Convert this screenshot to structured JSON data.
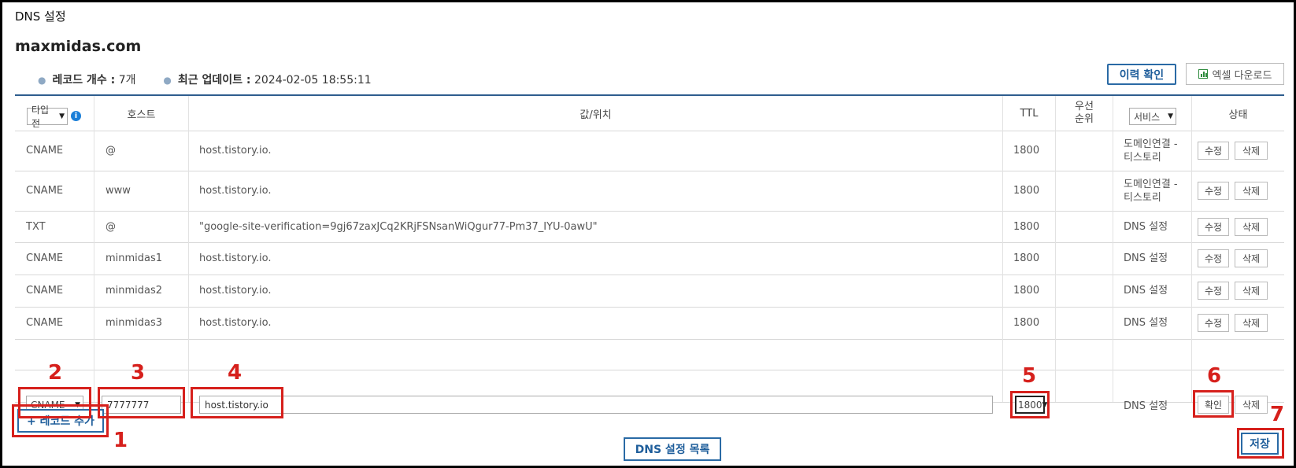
{
  "page_title": "DNS 설정",
  "domain": "maxmidas.com",
  "meta": {
    "record_count_label": "레코드 개수 :",
    "record_count_value": "7개",
    "updated_label": "최근 업데이트 :",
    "updated_value": "2024-02-05 18:55:11"
  },
  "actions": {
    "history_label": "이력 확인",
    "excel_label": "엑셀 다운로드"
  },
  "table": {
    "headers": {
      "type_select": "타입 전",
      "host": "호스트",
      "value": "값/위치",
      "ttl": "TTL",
      "priority_1": "우선",
      "priority_2": "순위",
      "service_select": "서비스",
      "status": "상태"
    },
    "rows": [
      {
        "type": "CNAME",
        "host": "@",
        "value": "host.tistory.io.",
        "ttl": "1800",
        "service_1": "도메인연결 -",
        "service_2": "티스토리",
        "edit": "수정",
        "delete": "삭제"
      },
      {
        "type": "CNAME",
        "host": "www",
        "value": "host.tistory.io.",
        "ttl": "1800",
        "service_1": "도메인연결 -",
        "service_2": "티스토리",
        "edit": "수정",
        "delete": "삭제"
      },
      {
        "type": "TXT",
        "host": "@",
        "value": "\"google-site-verification=9gj67zaxJCq2KRjFSNsanWiQgur77-Pm37_IYU-0awU\"",
        "ttl": "1800",
        "service_1": "DNS 설정",
        "service_2": "",
        "edit": "수정",
        "delete": "삭제"
      },
      {
        "type": "CNAME",
        "host": "minmidas1",
        "value": "host.tistory.io.",
        "ttl": "1800",
        "service_1": "DNS 설정",
        "service_2": "",
        "edit": "수정",
        "delete": "삭제"
      },
      {
        "type": "CNAME",
        "host": "minmidas2",
        "value": "host.tistory.io.",
        "ttl": "1800",
        "service_1": "DNS 설정",
        "service_2": "",
        "edit": "수정",
        "delete": "삭제"
      },
      {
        "type": "CNAME",
        "host": "minmidas3",
        "value": "host.tistory.io.",
        "ttl": "1800",
        "service_1": "DNS 설정",
        "service_2": "",
        "edit": "수정",
        "delete": "삭제"
      }
    ],
    "new_row": {
      "type": "CNAME",
      "host": "7777777",
      "value": "host.tistory.io",
      "ttl": "1800",
      "service": "DNS 설정",
      "confirm": "확인",
      "delete": "삭제"
    }
  },
  "bottom": {
    "add_record_label": "+ 레코드 추가",
    "dns_list_label": "DNS 설정 목록",
    "save_label": "저장"
  },
  "annotations": {
    "n1": "1",
    "n2": "2",
    "n3": "3",
    "n4": "4",
    "n5": "5",
    "n6": "6",
    "n7": "7",
    "color": "#d6201c"
  }
}
